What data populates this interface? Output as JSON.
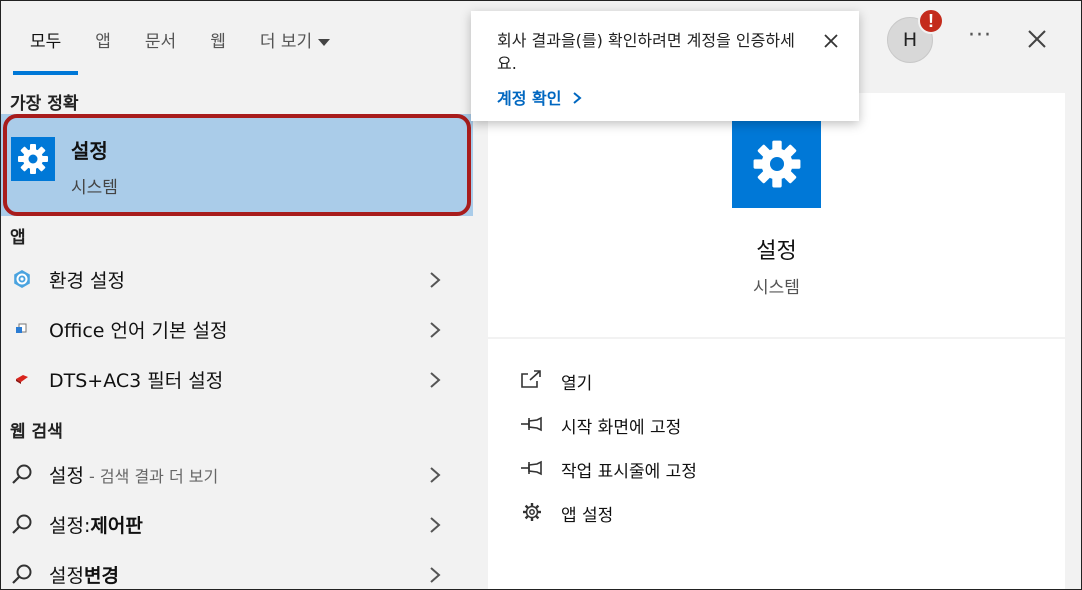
{
  "tabs": [
    {
      "label": "모두",
      "active": true
    },
    {
      "label": "앱",
      "active": false
    },
    {
      "label": "문서",
      "active": false
    },
    {
      "label": "웹",
      "active": false
    },
    {
      "label": "더 보기",
      "active": false
    }
  ],
  "account": {
    "avatar_letter": "H",
    "badge": "!"
  },
  "more_label": "···",
  "sections": {
    "best_match": "가장 정확",
    "apps": "앱",
    "web": "웹 검색"
  },
  "best_match": {
    "title": "설정",
    "subtitle": "시스템",
    "icon": "gear-icon"
  },
  "apps": [
    {
      "label": "환경 설정",
      "icon": "gear-icon"
    },
    {
      "label": "Office 언어 기본 설정",
      "icon": "office-language-icon"
    },
    {
      "label": "DTS+AC3 필터 설정",
      "icon": "filter-app-icon"
    }
  ],
  "web": [
    {
      "label": "설정",
      "hint": " - 검색 결과 더 보기",
      "bold": ""
    },
    {
      "label": "설정:",
      "hint": "",
      "bold": "제어판"
    },
    {
      "label": "설정",
      "hint": "",
      "bold": "변경"
    }
  ],
  "detail": {
    "title": "설정",
    "subtitle": "시스템",
    "actions": [
      {
        "label": "열기",
        "icon": "open-icon"
      },
      {
        "label": "시작 화면에 고정",
        "icon": "pin-icon"
      },
      {
        "label": "작업 표시줄에 고정",
        "icon": "pin-icon"
      },
      {
        "label": "앱 설정",
        "icon": "gear-icon"
      }
    ]
  },
  "toast": {
    "message": "회사 결과을(를) 확인하려면 계정을 인증하세요.",
    "link": "계정 확인"
  },
  "colors": {
    "accent": "#0078d7",
    "highlight": "#aacce9",
    "outline": "#a81c1c",
    "badge": "#c42b1c"
  }
}
